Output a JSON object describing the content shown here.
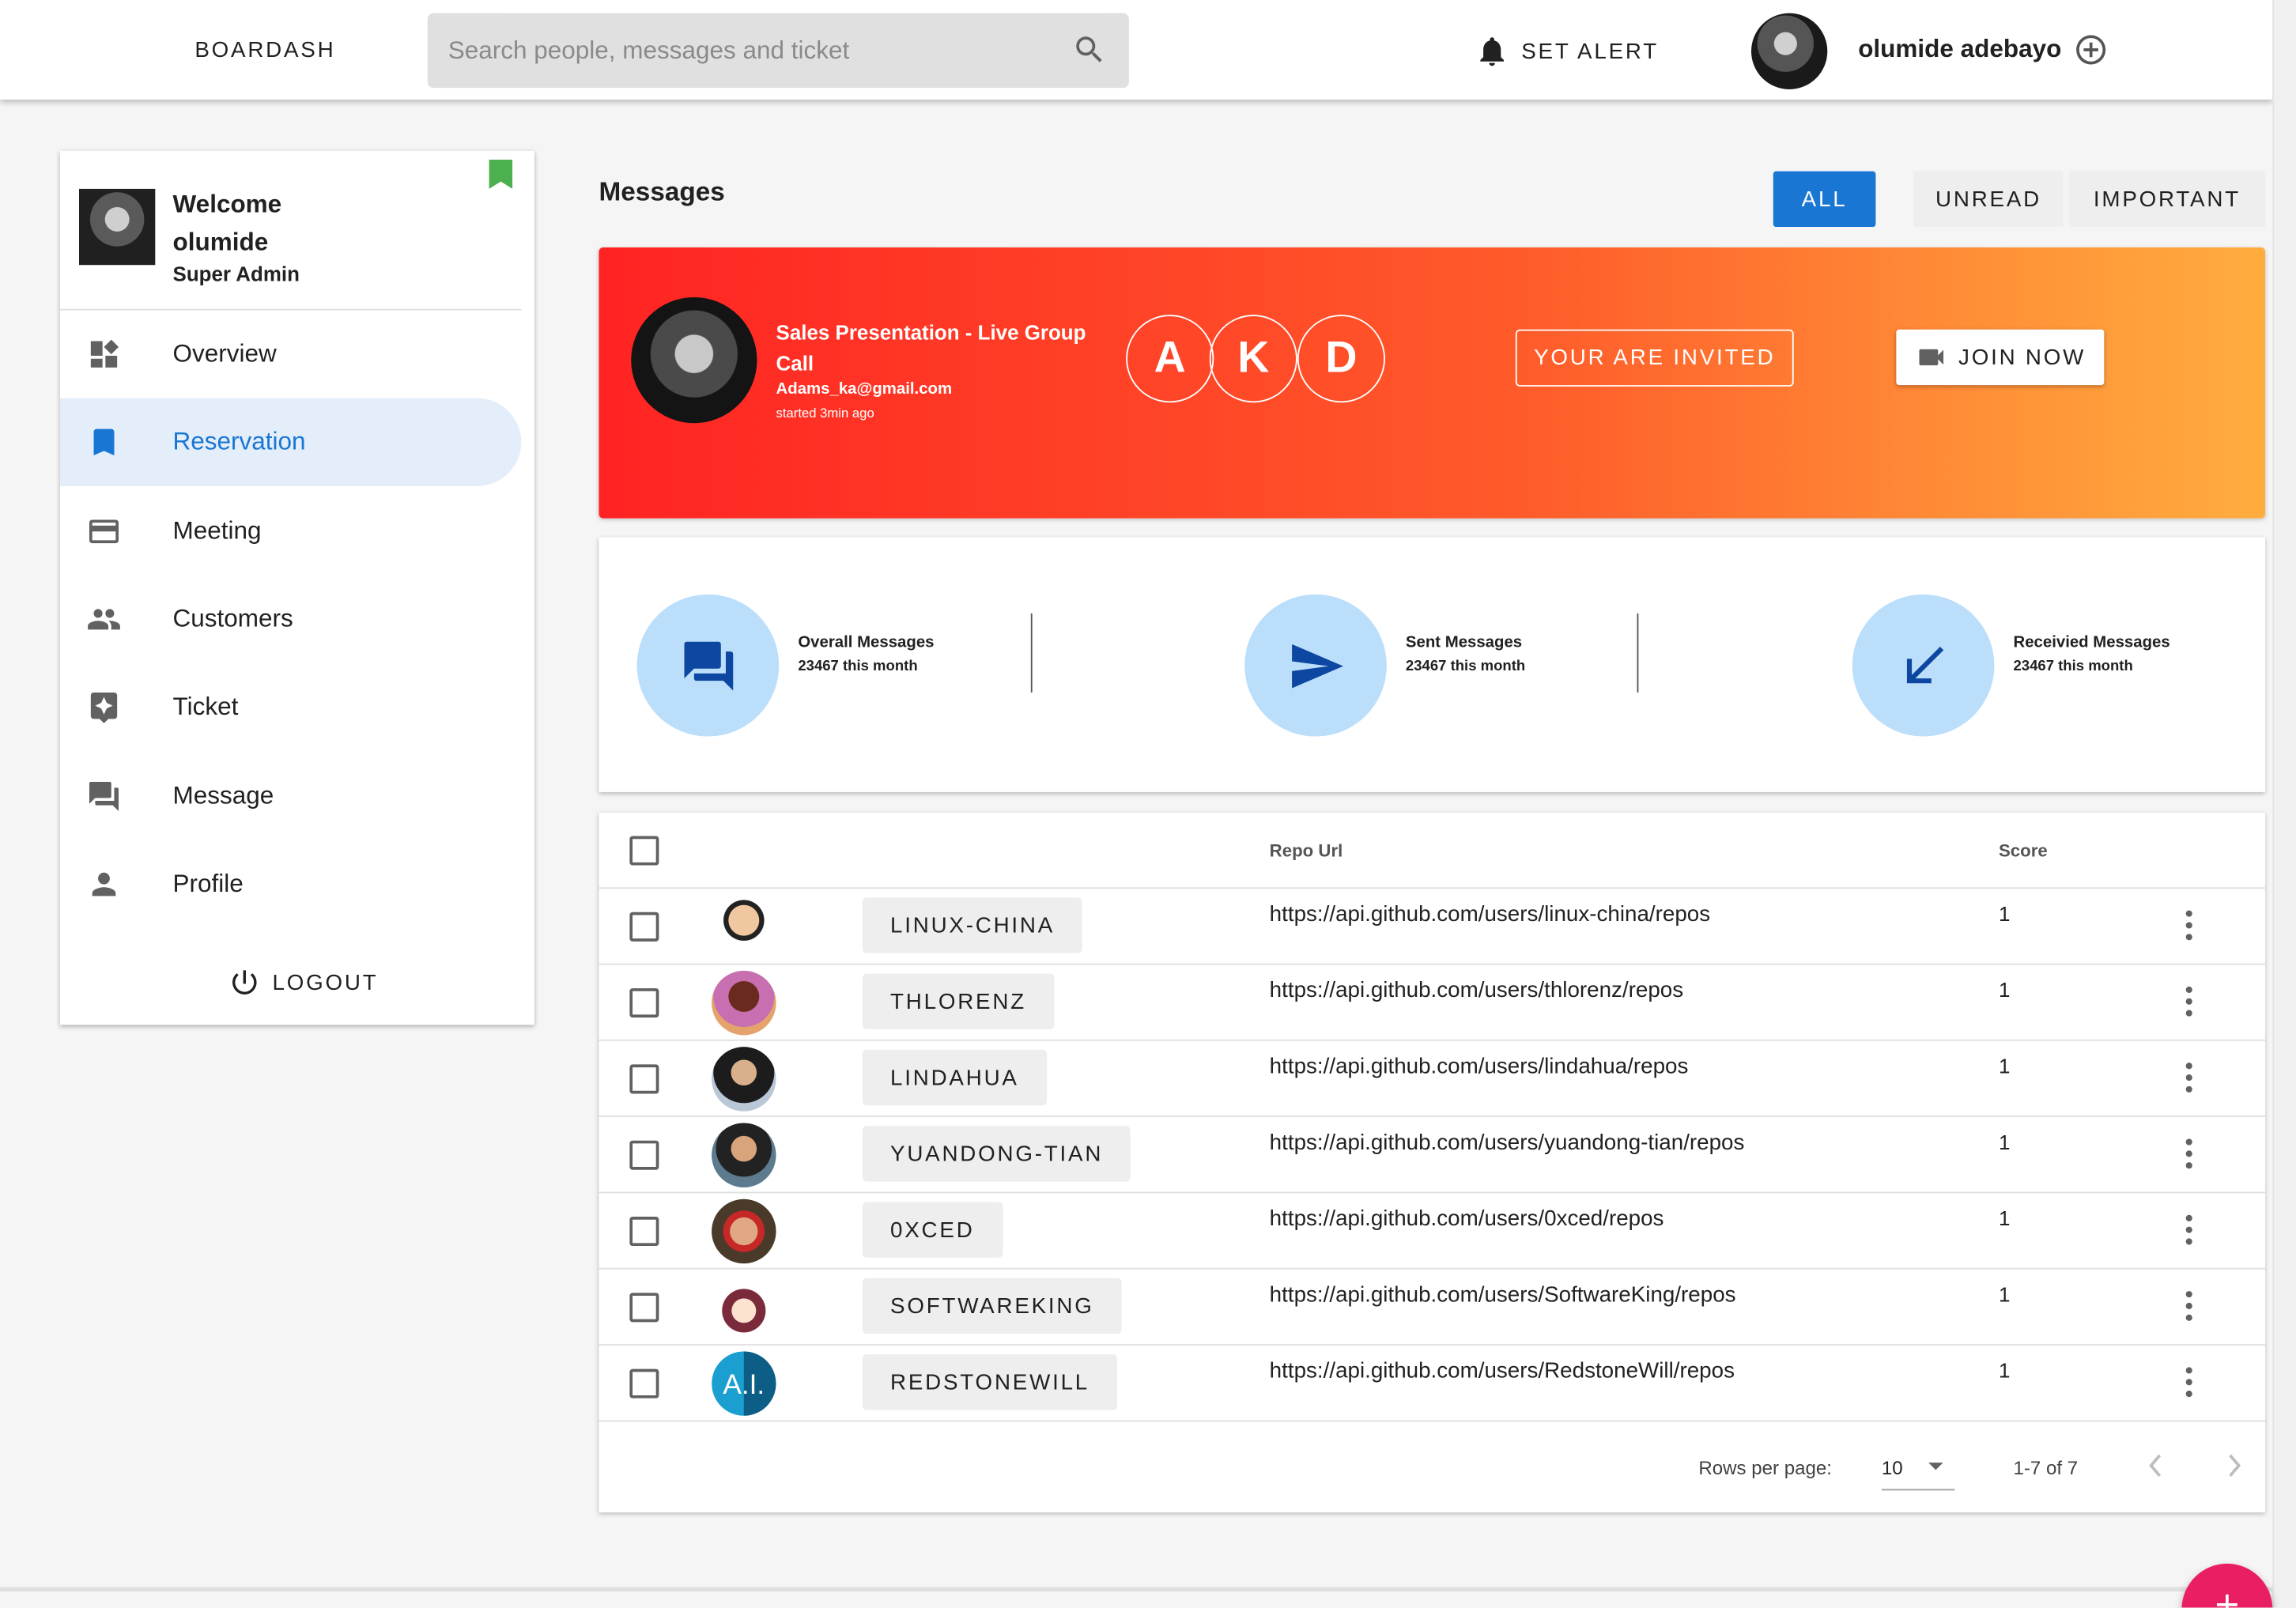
{
  "topbar": {
    "brand": "BOARDASH",
    "search_placeholder": "Search people, messages and ticket",
    "set_alert": "SET ALERT",
    "username": "olumide adebayo"
  },
  "sidebar": {
    "welcome_line1": "Welcome",
    "welcome_line2": "olumide",
    "role": "Super Admin",
    "items": [
      {
        "label": "Overview",
        "icon": "dashboard-icon",
        "active": false
      },
      {
        "label": "Reservation",
        "icon": "bookmark-icon",
        "active": true
      },
      {
        "label": "Meeting",
        "icon": "credit-card-icon",
        "active": false
      },
      {
        "label": "Customers",
        "icon": "people-icon",
        "active": false
      },
      {
        "label": "Ticket",
        "icon": "ticket-icon",
        "active": false
      },
      {
        "label": "Message",
        "icon": "forum-icon",
        "active": false
      },
      {
        "label": "Profile",
        "icon": "person-icon",
        "active": false
      }
    ],
    "logout": "LOGOUT"
  },
  "main": {
    "title": "Messages",
    "filters": [
      "ALL",
      "UNREAD",
      "IMPORTANT"
    ],
    "active_filter": "ALL"
  },
  "banner": {
    "title": "Sales Presentation - Live Group Call",
    "email": "Adams_ka@gmail.com",
    "started": "started 3min ago",
    "participants": [
      "A",
      "K",
      "D"
    ],
    "invited": "YOUR ARE INVITED",
    "join": "JOIN NOW"
  },
  "stats": [
    {
      "title": "Overall Messages",
      "sub": "23467 this month",
      "icon": "forum-icon"
    },
    {
      "title": "Sent Messages",
      "sub": "23467 this month",
      "icon": "send-icon"
    },
    {
      "title": "Receivied Messages",
      "sub": "23467 this month",
      "icon": "arrow-down-left-icon"
    }
  ],
  "table": {
    "columns": {
      "repo_url": "Repo Url",
      "score": "Score"
    },
    "rows": [
      {
        "name": "LINUX-CHINA",
        "url": "https://api.github.com/users/linux-china/repos",
        "score": "1"
      },
      {
        "name": "THLORENZ",
        "url": "https://api.github.com/users/thlorenz/repos",
        "score": "1"
      },
      {
        "name": "LINDAHUA",
        "url": "https://api.github.com/users/lindahua/repos",
        "score": "1"
      },
      {
        "name": "YUANDONG-TIAN",
        "url": "https://api.github.com/users/yuandong-tian/repos",
        "score": "1"
      },
      {
        "name": "0XCED",
        "url": "https://api.github.com/users/0xced/repos",
        "score": "1"
      },
      {
        "name": "SOFTWAREKING",
        "url": "https://api.github.com/users/SoftwareKing/repos",
        "score": "1"
      },
      {
        "name": "REDSTONEWILL",
        "url": "https://api.github.com/users/RedstoneWill/repos",
        "score": "1"
      }
    ],
    "rows_per_page_label": "Rows per page:",
    "rows_per_page": "10",
    "range": "1-7 of 7"
  },
  "colors": {
    "primary": "#1976d2",
    "banner_start": "#ff2323",
    "banner_end": "#ffad3f",
    "stat_circle": "#bbdefb",
    "fab": "#e91e63",
    "bookmark_green": "#4caf50"
  }
}
